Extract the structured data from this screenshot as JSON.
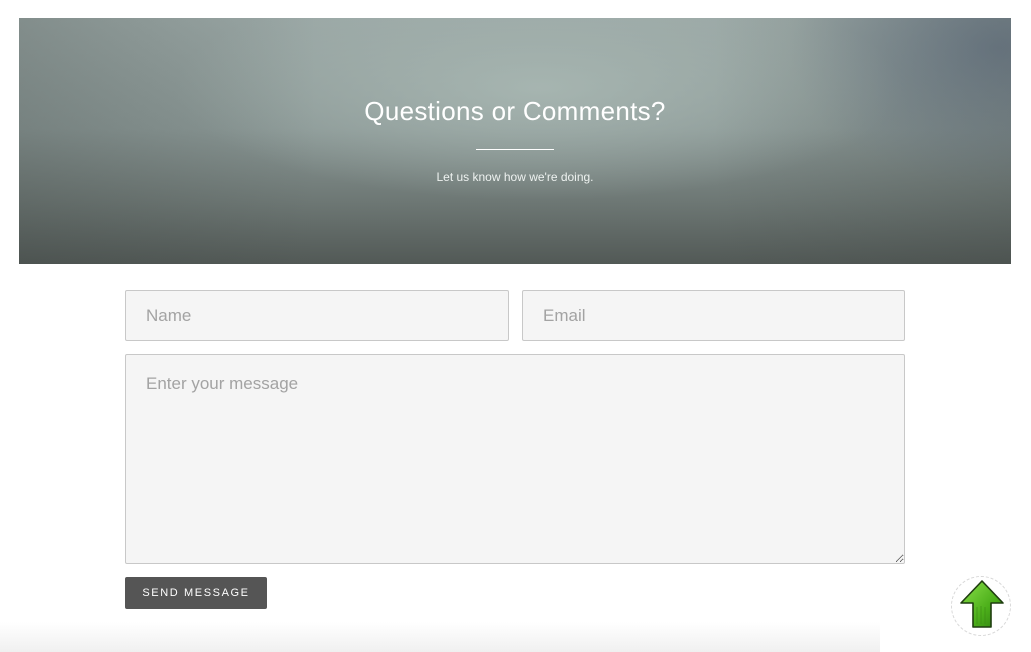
{
  "hero": {
    "title": "Questions or Comments?",
    "subtitle": "Let us know how we're doing."
  },
  "form": {
    "name_placeholder": "Name",
    "email_placeholder": "Email",
    "message_placeholder": "Enter your message",
    "submit_label": "SEND MESSAGE"
  },
  "scroll_top": {
    "icon": "arrow-up-icon",
    "color": "#4caf1a"
  }
}
